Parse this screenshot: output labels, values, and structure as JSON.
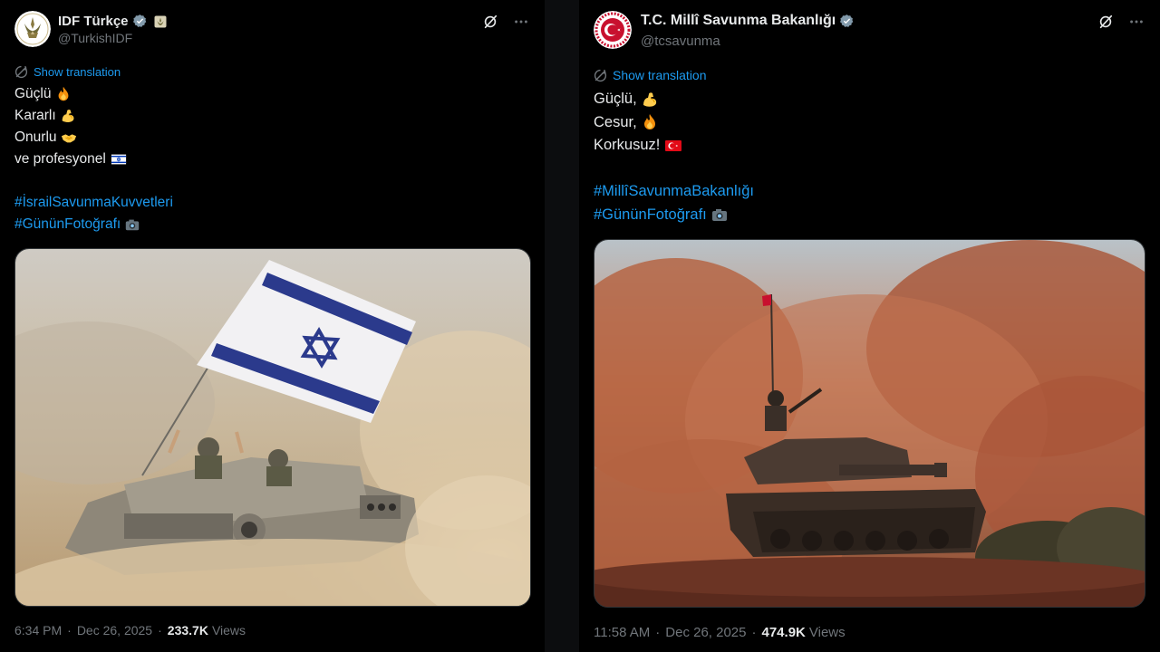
{
  "tweets": [
    {
      "display_name": "IDF Türkçe",
      "handle": "@TurkishIDF",
      "translate_label": "Show translation",
      "lines": [
        "Güçlü",
        "Kararlı",
        "Onurlu",
        "ve profesyonel"
      ],
      "hashtags": [
        "#İsrailSavunmaKuvvetleri",
        "#GününFotoğrafı"
      ],
      "time": "6:34 PM",
      "date": "Dec 26, 2025",
      "views_count": "233.7K",
      "views_label": "Views",
      "icons": {
        "verified": "verified-badge-icon",
        "affiliate": "affiliate-badge-icon",
        "grok": "grok-icon",
        "more": "more-icon"
      }
    },
    {
      "display_name": "T.C. Millî Savunma Bakanlığı",
      "handle": "@tcsavunma",
      "translate_label": "Show translation",
      "lines": [
        "Güçlü,",
        "Cesur,",
        "Korkusuz!"
      ],
      "hashtags": [
        "#MillîSavunmaBakanlığı",
        "#GününFotoğrafı"
      ],
      "time": "11:58 AM",
      "date": "Dec 26, 2025",
      "views_count": "474.9K",
      "views_label": "Views",
      "icons": {
        "verified": "verified-badge-icon",
        "grok": "grok-icon",
        "more": "more-icon"
      }
    }
  ],
  "colors": {
    "background": "#000000",
    "text": "#e7e9ea",
    "muted": "#71767b",
    "link": "#1d9bf0"
  }
}
